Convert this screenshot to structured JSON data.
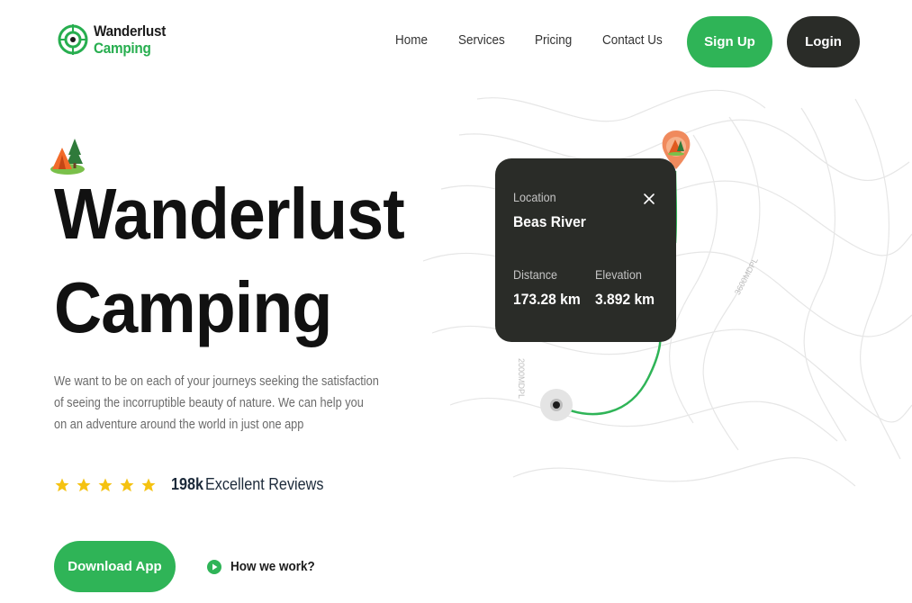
{
  "brand": {
    "line1": "Wanderlust",
    "line2": "Camping"
  },
  "nav": {
    "items": [
      "Home",
      "Services",
      "Pricing",
      "Contact Us"
    ]
  },
  "auth": {
    "signup": "Sign Up",
    "login": "Login"
  },
  "hero": {
    "title_line1": "Wanderlust",
    "title_line2": "Camping",
    "description": "We want to be on each of your journeys seeking the satisfaction of seeing the incorruptible beauty of nature. We can help you on an adventure around the world in just one app"
  },
  "rating": {
    "stars": 5,
    "count": "198k",
    "label": "Excellent Reviews"
  },
  "cta": {
    "download": "Download App",
    "how": "How we work?"
  },
  "map": {
    "contour_label_1": "3600MDPL",
    "contour_label_2": "2000MDPL",
    "card": {
      "location_label": "Location",
      "location_value": "Beas River",
      "distance_label": "Distance",
      "distance_value": "173.28 km",
      "elevation_label": "Elevation",
      "elevation_value": "3.892 km"
    }
  },
  "colors": {
    "accent": "#2fb457",
    "dark": "#2a2c28",
    "star": "#f5c211",
    "pin": "#f08a5d"
  }
}
